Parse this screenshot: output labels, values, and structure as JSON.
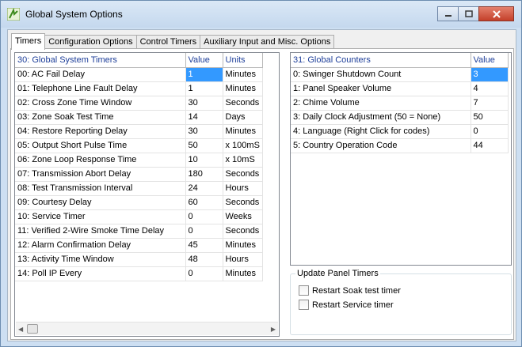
{
  "window": {
    "title": "Global System Options"
  },
  "tabs": [
    {
      "label": "Timers"
    },
    {
      "label": "Configuration Options"
    },
    {
      "label": "Control Timers"
    },
    {
      "label": "Auxiliary Input and Misc. Options"
    }
  ],
  "timers_grid": {
    "columns": [
      "30: Global System Timers",
      "Value",
      "Units"
    ],
    "rows": [
      [
        "00: AC Fail Delay",
        "1",
        "Minutes"
      ],
      [
        "01: Telephone Line Fault Delay",
        "1",
        "Minutes"
      ],
      [
        "02: Cross Zone Time Window",
        "30",
        "Seconds"
      ],
      [
        "03: Zone Soak Test Time",
        "14",
        "Days"
      ],
      [
        "04: Restore Reporting Delay",
        "30",
        "Minutes"
      ],
      [
        "05: Output Short Pulse Time",
        "50",
        "x 100mS"
      ],
      [
        "06: Zone Loop Response Time",
        "10",
        "x 10mS"
      ],
      [
        "07: Transmission Abort Delay",
        "180",
        "Seconds"
      ],
      [
        "08: Test Transmission Interval",
        "24",
        "Hours"
      ],
      [
        "09: Courtesy Delay",
        "60",
        "Seconds"
      ],
      [
        "10: Service Timer",
        "0",
        "Weeks"
      ],
      [
        "11: Verified 2-Wire Smoke Time Delay",
        "0",
        "Seconds"
      ],
      [
        "12: Alarm Confirmation Delay",
        "45",
        "Minutes"
      ],
      [
        "13: Activity Time Window",
        "48",
        "Hours"
      ],
      [
        "14: Poll IP Every",
        "0",
        "Minutes"
      ]
    ]
  },
  "counters_grid": {
    "columns": [
      "31: Global Counters",
      "Value"
    ],
    "rows": [
      [
        "0: Swinger Shutdown Count",
        "3"
      ],
      [
        "1: Panel Speaker Volume",
        "4"
      ],
      [
        "2: Chime Volume",
        "7"
      ],
      [
        "3: Daily Clock Adjustment (50 = None)",
        "50"
      ],
      [
        "4: Language (Right Click for codes)",
        "0"
      ],
      [
        "5: Country Operation Code",
        "44"
      ]
    ]
  },
  "update_panel": {
    "title": "Update Panel Timers",
    "checkboxes": [
      {
        "label": "Restart Soak test timer",
        "checked": false
      },
      {
        "label": "Restart Service timer",
        "checked": false
      }
    ]
  },
  "icons": {
    "app": "app-icon",
    "minimize": "minimize-icon",
    "maximize": "maximize-icon",
    "close": "close-icon",
    "scroll_left": "arrow-left-icon",
    "scroll_right": "arrow-right-icon"
  },
  "colors": {
    "header_text": "#1e3f9a",
    "selection": "#3399ff",
    "close_button": "#c4402a"
  }
}
